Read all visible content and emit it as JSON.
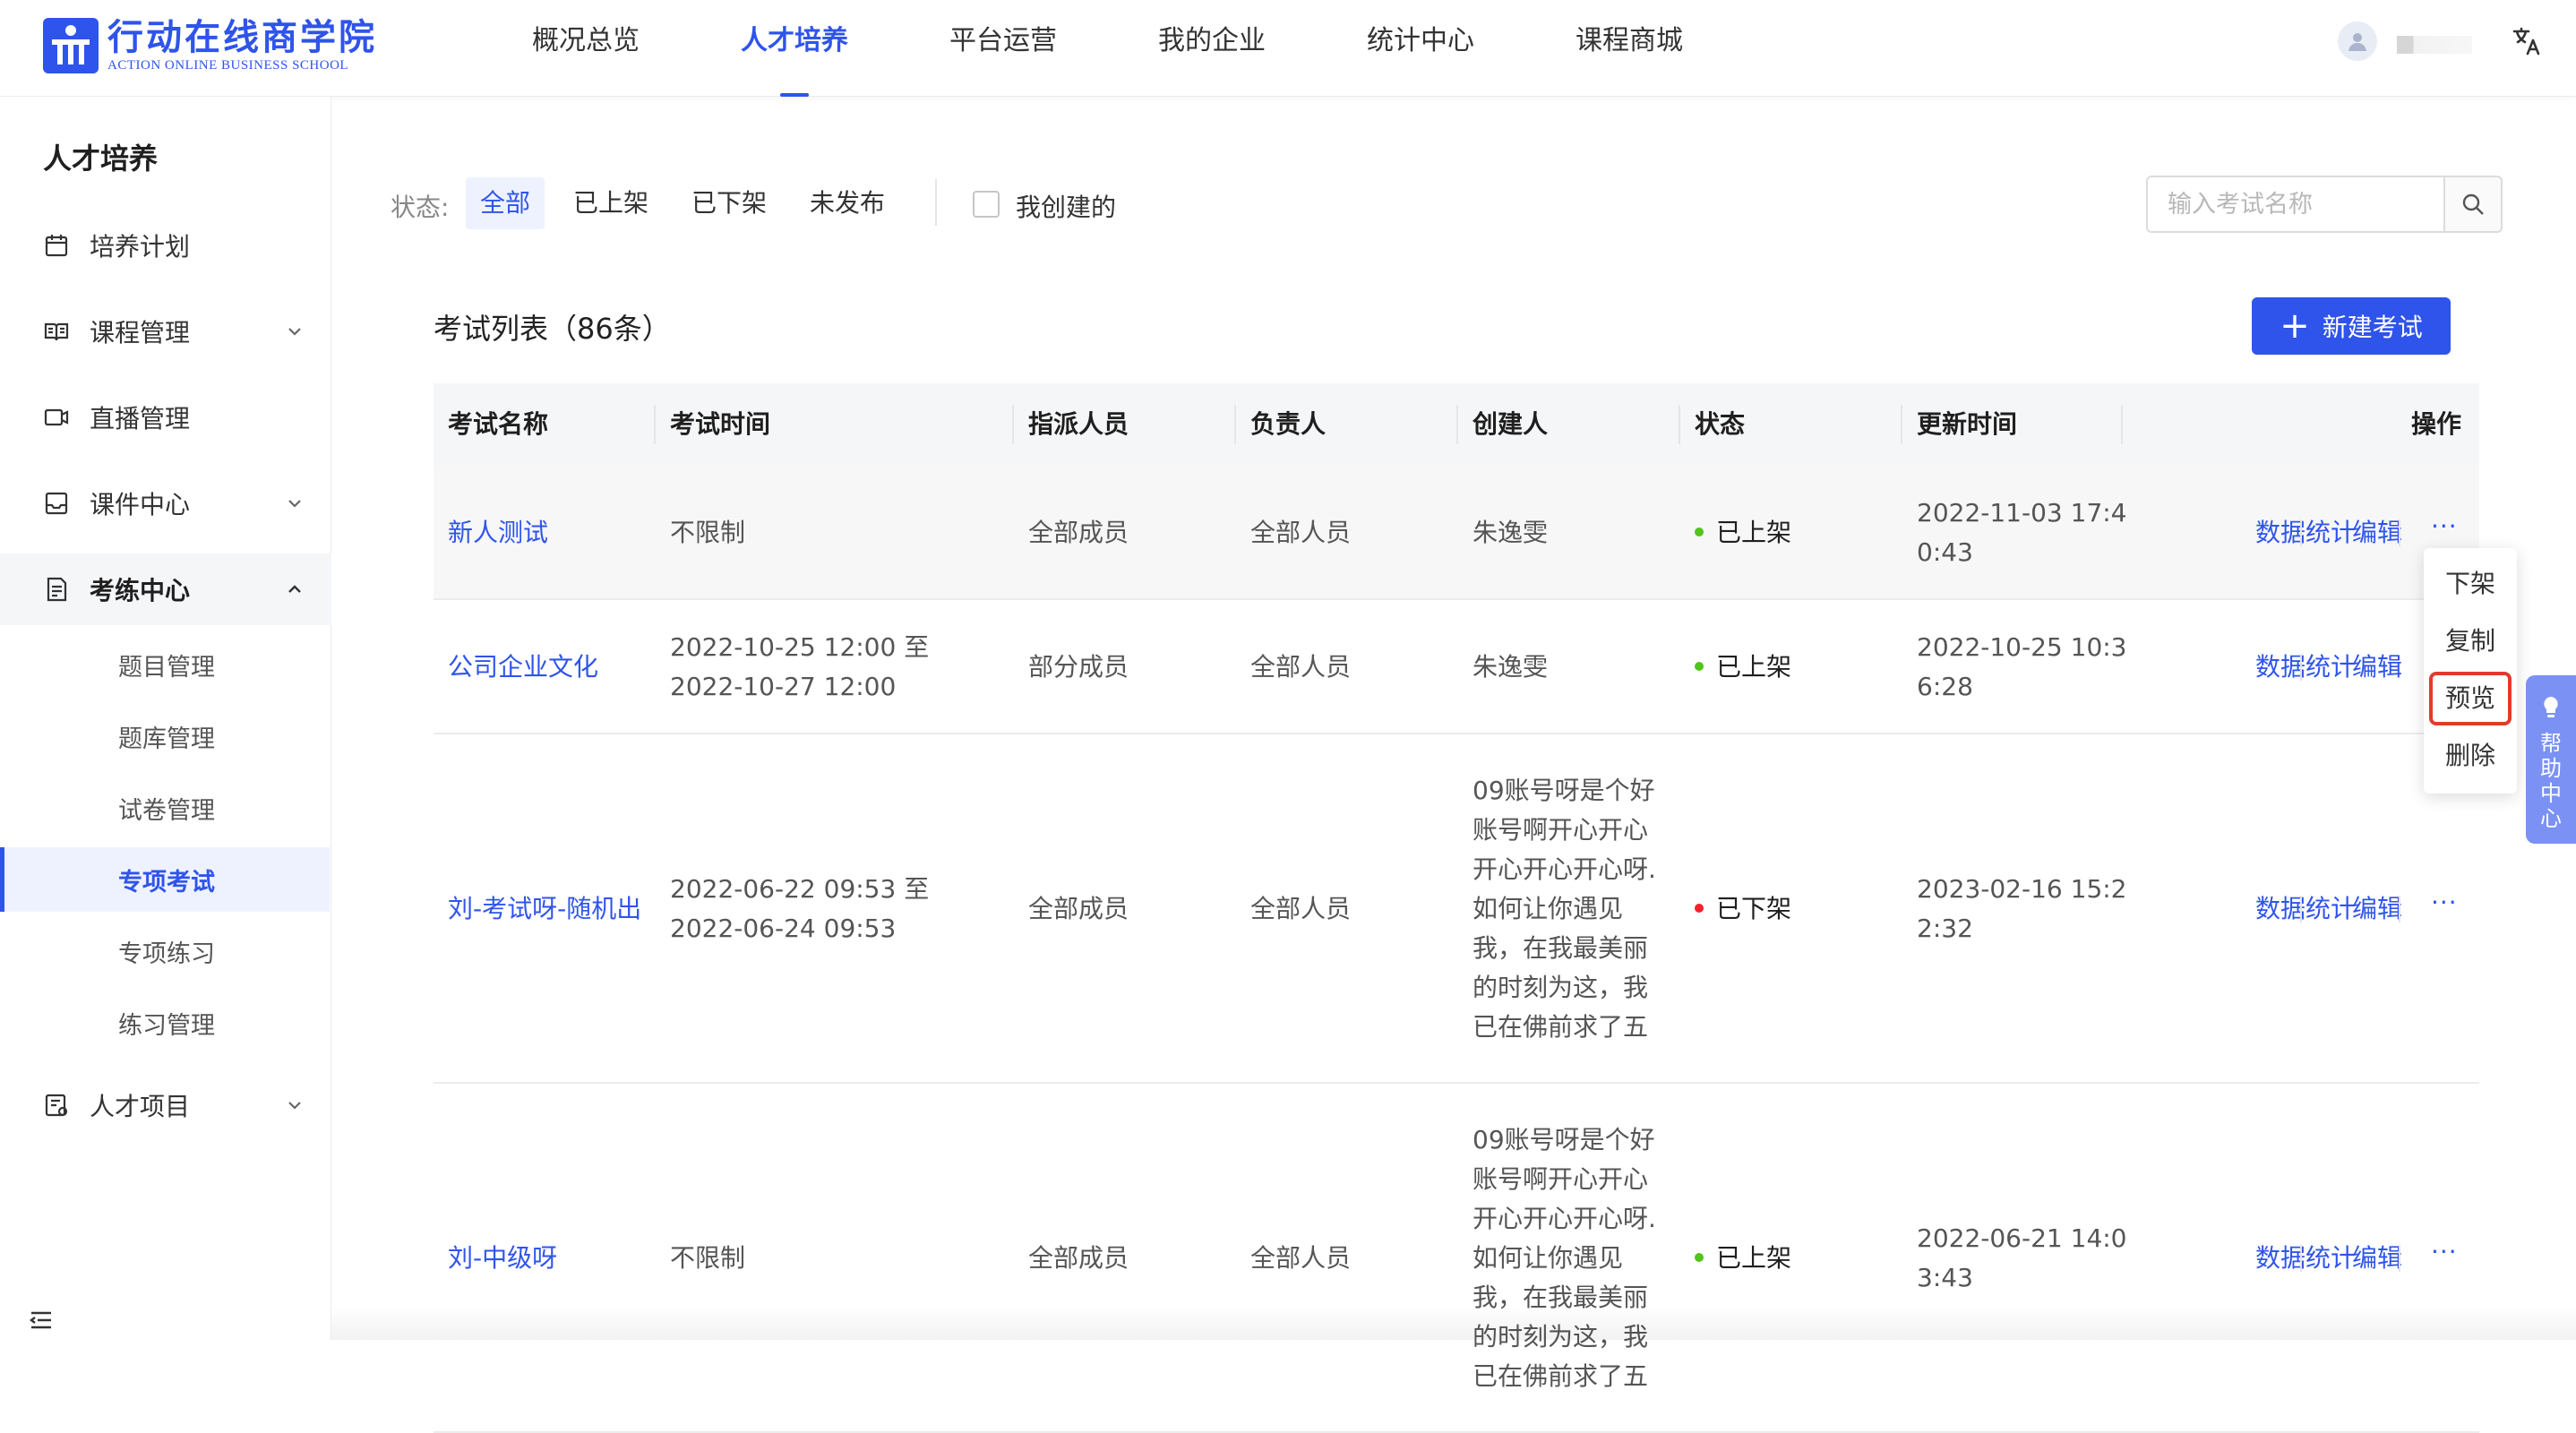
{
  "brand": {
    "name_cn": "行动在线商学院",
    "name_en": "ACTION ONLINE BUSINESS SCHOOL",
    "color": "#2f54eb"
  },
  "topnav": [
    {
      "label": "概况总览",
      "active": false
    },
    {
      "label": "人才培养",
      "active": true
    },
    {
      "label": "平台运营",
      "active": false
    },
    {
      "label": "我的企业",
      "active": false
    },
    {
      "label": "统计中心",
      "active": false
    },
    {
      "label": "课程商城",
      "active": false
    }
  ],
  "header_icons": {
    "avatar": "user-avatar-icon",
    "language": "translate-icon"
  },
  "sidebar": {
    "title": "人才培养",
    "items": [
      {
        "label": "培养计划",
        "icon": "calendar-icon",
        "expandable": false
      },
      {
        "label": "课程管理",
        "icon": "book-icon",
        "expandable": true
      },
      {
        "label": "直播管理",
        "icon": "video-icon",
        "expandable": false
      },
      {
        "label": "课件中心",
        "icon": "inbox-icon",
        "expandable": true
      },
      {
        "label": "考练中心",
        "icon": "exam-icon",
        "expandable": true,
        "open": true
      },
      {
        "label": "人才项目",
        "icon": "project-icon",
        "expandable": true
      }
    ],
    "subitems": [
      {
        "label": "题目管理"
      },
      {
        "label": "题库管理"
      },
      {
        "label": "试卷管理"
      },
      {
        "label": "专项考试",
        "active": true
      },
      {
        "label": "专项练习"
      },
      {
        "label": "练习管理"
      }
    ]
  },
  "filter": {
    "label": "状态:",
    "options": [
      "全部",
      "已上架",
      "已下架",
      "未发布"
    ],
    "selected": "全部",
    "mine_label": "我创建的",
    "mine_checked": false,
    "search_placeholder": "输入考试名称",
    "search_value": ""
  },
  "list": {
    "title": "考试列表（86条）",
    "new_button": "新建考试"
  },
  "table": {
    "columns": [
      "考试名称",
      "考试时间",
      "指派人员",
      "负责人",
      "创建人",
      "状态",
      "更新时间",
      "操作"
    ],
    "rows": [
      {
        "name": "新人测试",
        "time": [
          "不限制"
        ],
        "assignee": "全部成员",
        "owner": "全部人员",
        "creator": [
          "朱逸雯"
        ],
        "status": "已上架",
        "status_color": "#52c41a",
        "updated": [
          "2022-11-03 17:4",
          "0:43"
        ],
        "ops": [
          "数据统计",
          "编辑",
          "···"
        ]
      },
      {
        "name": "公司企业文化",
        "time": [
          "2022-10-25 12:00 至",
          "2022-10-27 12:00"
        ],
        "assignee": "部分成员",
        "owner": "全部人员",
        "creator": [
          "朱逸雯"
        ],
        "status": "已上架",
        "status_color": "#52c41a",
        "updated": [
          "2022-10-25 10:3",
          "6:28"
        ],
        "ops": [
          "数据统计",
          "编辑"
        ]
      },
      {
        "name": "刘-考试呀-随机出",
        "time": [
          "2022-06-22 09:53 至",
          "2022-06-24 09:53"
        ],
        "assignee": "全部成员",
        "owner": "全部人员",
        "creator": [
          "09账号呀是个好",
          "账号啊开心开心",
          "开心开心开心呀.",
          "如何让你遇见",
          "我，在我最美丽",
          "的时刻为这，我",
          "已在佛前求了五"
        ],
        "status": "已下架",
        "status_color": "#f5222d",
        "updated": [
          "2023-02-16 15:2",
          "2:32"
        ],
        "ops": [
          "数据统计",
          "编辑",
          "···"
        ]
      },
      {
        "name": "刘-中级呀",
        "time": [
          "不限制"
        ],
        "assignee": "全部成员",
        "owner": "全部人员",
        "creator": [
          "09账号呀是个好",
          "账号啊开心开心",
          "开心开心开心呀.",
          "如何让你遇见",
          "我，在我最美丽",
          "的时刻为这，我",
          "已在佛前求了五"
        ],
        "status": "已上架",
        "status_color": "#52c41a",
        "updated": [
          "2022-06-21 14:0",
          "3:43"
        ],
        "ops": [
          "数据统计",
          "编辑",
          "···"
        ]
      }
    ]
  },
  "dropdown": {
    "items": [
      "下架",
      "复制",
      "预览",
      "删除"
    ],
    "highlighted": "预览"
  },
  "help": {
    "label": "帮助中心",
    "icon": "lightbulb-icon"
  }
}
